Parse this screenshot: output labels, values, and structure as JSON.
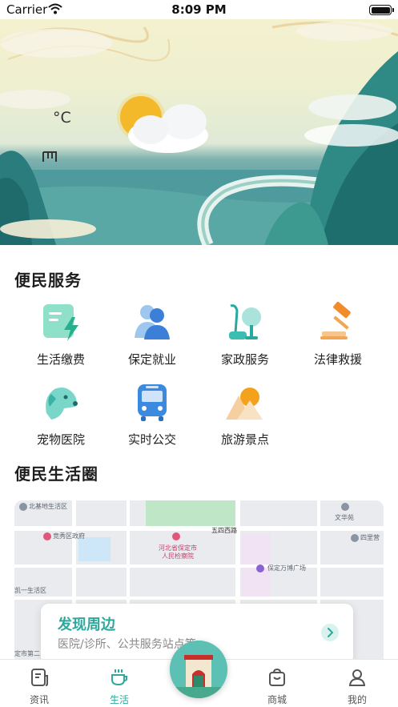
{
  "status_bar": {
    "carrier": "Carrier",
    "time": "8:09 PM"
  },
  "banner": {
    "temperature": "°C",
    "weather_text": ""
  },
  "convenience_services": {
    "title": "便民服务",
    "items": [
      {
        "label": "生活缴费",
        "icon": "bill-payment-icon"
      },
      {
        "label": "保定就业",
        "icon": "employment-icon"
      },
      {
        "label": "家政服务",
        "icon": "housekeeping-icon"
      },
      {
        "label": "法律救援",
        "icon": "legal-aid-icon"
      },
      {
        "label": "宠物医院",
        "icon": "pet-hospital-icon"
      },
      {
        "label": "实时公交",
        "icon": "bus-icon"
      },
      {
        "label": "旅游景点",
        "icon": "scenic-spot-icon"
      }
    ]
  },
  "life_circle": {
    "title": "便民生活圈",
    "map_labels": [
      "北基地生活区",
      "竞秀区政府",
      "河北省保定市",
      "人民检察院",
      "五四西路",
      "保定万博广场",
      "文华苑",
      "四里营",
      "凯一生活区",
      "定市第二"
    ],
    "discover": {
      "title": "发现周边",
      "subtitle": "医院/诊所、公共服务站点等"
    }
  },
  "tabbar": {
    "items": [
      {
        "label": "资讯",
        "icon": "news-icon"
      },
      {
        "label": "生活",
        "icon": "coffee-cup-icon"
      },
      {
        "label": "",
        "icon": "gate-icon"
      },
      {
        "label": "商城",
        "icon": "shop-icon"
      },
      {
        "label": "我的",
        "icon": "profile-icon"
      }
    ],
    "active_color": "#2fa79b"
  }
}
